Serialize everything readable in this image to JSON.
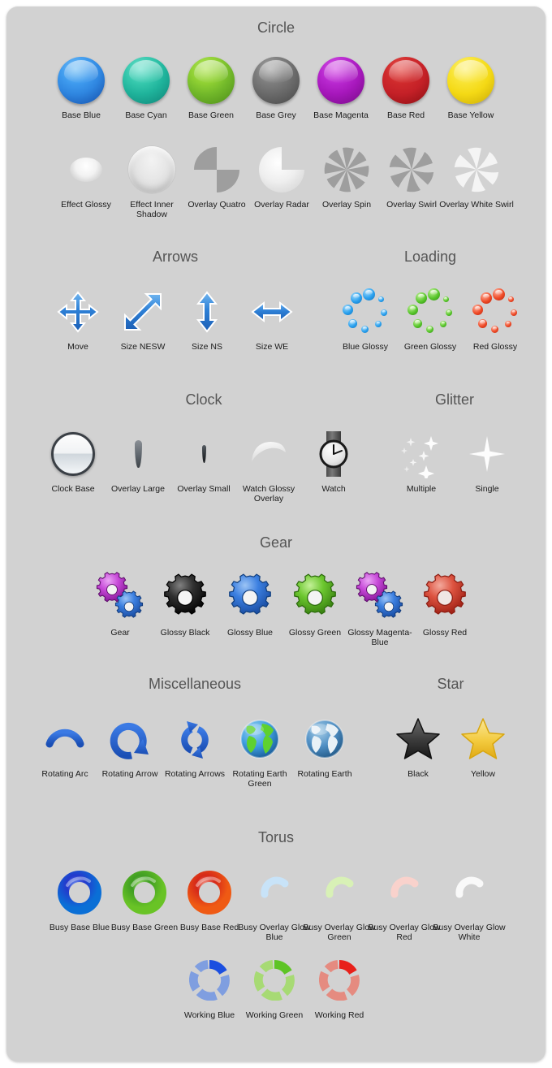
{
  "page": {
    "background": "#d2d2d2",
    "title_color": "#555555",
    "label_color": "#1b1b1b"
  },
  "sections": [
    {
      "id": "circle",
      "title": "Circle",
      "items": [
        {
          "label": "Base Blue",
          "icon": "circle-base-blue",
          "color": "#2f86e0"
        },
        {
          "label": "Base Cyan",
          "icon": "circle-base-cyan",
          "color": "#1fb39b"
        },
        {
          "label": "Base Green",
          "icon": "circle-base-green",
          "color": "#72b82a"
        },
        {
          "label": "Base Grey",
          "icon": "circle-base-grey",
          "color": "#6a6a6a"
        },
        {
          "label": "Base Magenta",
          "icon": "circle-base-magenta",
          "color": "#a617bb"
        },
        {
          "label": "Base Red",
          "icon": "circle-base-red",
          "color": "#c42027"
        },
        {
          "label": "Base Yellow",
          "icon": "circle-base-yellow",
          "color": "#f4d915"
        },
        {
          "label": "Effect Glossy",
          "icon": "circle-effect-glossy",
          "color": "#ffffff"
        },
        {
          "label": "Effect Inner Shadow",
          "icon": "circle-effect-inner-shadow",
          "color": "#e3e3e3"
        },
        {
          "label": "Overlay Quatro",
          "icon": "circle-overlay-quatro",
          "color": "#9e9e9e"
        },
        {
          "label": "Overlay Radar",
          "icon": "circle-overlay-radar",
          "color": "#f0f0f0"
        },
        {
          "label": "Overlay Spin",
          "icon": "circle-overlay-spin",
          "color": "#9e9e9e"
        },
        {
          "label": "Overlay Swirl",
          "icon": "circle-overlay-swirl",
          "color": "#9e9e9e"
        },
        {
          "label": "Overlay White Swirl",
          "icon": "circle-overlay-white-swirl",
          "color": "#f2f2f2"
        }
      ]
    },
    {
      "id": "arrows",
      "title": "Arrows",
      "items": [
        {
          "label": "Move",
          "icon": "arrow-move",
          "color": "#2a7fd4"
        },
        {
          "label": "Size NESW",
          "icon": "arrow-size-nesw",
          "color": "#2a7fd4"
        },
        {
          "label": "Size NS",
          "icon": "arrow-size-ns",
          "color": "#2a7fd4"
        },
        {
          "label": "Size WE",
          "icon": "arrow-size-we",
          "color": "#2a7fd4"
        }
      ]
    },
    {
      "id": "loading",
      "title": "Loading",
      "items": [
        {
          "label": "Blue Glossy",
          "icon": "loading-blue-glossy",
          "color": "#2196e8"
        },
        {
          "label": "Green Glossy",
          "icon": "loading-green-glossy",
          "color": "#4cb822"
        },
        {
          "label": "Red Glossy",
          "icon": "loading-red-glossy",
          "color": "#e8391a"
        }
      ]
    },
    {
      "id": "clock",
      "title": "Clock",
      "items": [
        {
          "label": "Clock Base",
          "icon": "clock-base",
          "color": "#3a3f45"
        },
        {
          "label": "Overlay Large",
          "icon": "clock-overlay-large",
          "color": "#5f666d"
        },
        {
          "label": "Overlay Small",
          "icon": "clock-overlay-small",
          "color": "#2b2f33"
        },
        {
          "label": "Watch Glossy Overlay",
          "icon": "clock-watch-glossy",
          "color": "#f0f0f0"
        },
        {
          "label": "Watch",
          "icon": "clock-watch",
          "color": "#1f1f1f"
        }
      ]
    },
    {
      "id": "glitter",
      "title": "Glitter",
      "items": [
        {
          "label": "Multiple",
          "icon": "glitter-multiple",
          "color": "#ffffff"
        },
        {
          "label": "Single",
          "icon": "glitter-single",
          "color": "#ffffff"
        }
      ]
    },
    {
      "id": "gear",
      "title": "Gear",
      "items": [
        {
          "label": "Gear",
          "icon": "gear-magenta-blue-pair",
          "color": "#c23fd4"
        },
        {
          "label": "Glossy Black",
          "icon": "gear-glossy-black",
          "color": "#2a2a2a"
        },
        {
          "label": "Glossy Blue",
          "icon": "gear-glossy-blue",
          "color": "#2f6fd8"
        },
        {
          "label": "Glossy Green",
          "icon": "gear-glossy-green",
          "color": "#5fc128"
        },
        {
          "label": "Glossy Magenta-Blue",
          "icon": "gear-glossy-magenta-blue",
          "color": "#c23fd4"
        },
        {
          "label": "Glossy Red",
          "icon": "gear-glossy-red",
          "color": "#d9422e"
        }
      ]
    },
    {
      "id": "miscellaneous",
      "title": "Miscellaneous",
      "items": [
        {
          "label": "Rotating Arc",
          "icon": "misc-rotating-arc",
          "color": "#2a6fd8"
        },
        {
          "label": "Rotating Arrow",
          "icon": "misc-rotating-arrow",
          "color": "#2a6fd8"
        },
        {
          "label": "Rotating Arrows",
          "icon": "misc-rotating-arrows",
          "color": "#2a6fd8"
        },
        {
          "label": "Rotating Earth Green",
          "icon": "misc-rotating-earth-green",
          "color": "#55c32c"
        },
        {
          "label": "Rotating Earth",
          "icon": "misc-rotating-earth",
          "color": "#4f8fc4"
        }
      ]
    },
    {
      "id": "star",
      "title": "Star",
      "items": [
        {
          "label": "Black",
          "icon": "star-black",
          "color": "#3b3b3b"
        },
        {
          "label": "Yellow",
          "icon": "star-yellow",
          "color": "#f4cc35"
        }
      ]
    },
    {
      "id": "torus",
      "title": "Torus",
      "items": [
        {
          "label": "Busy Base Blue",
          "icon": "torus-busy-base-blue",
          "color": "#1a3fd0"
        },
        {
          "label": "Busy Base Green",
          "icon": "torus-busy-base-green",
          "color": "#3d9f22"
        },
        {
          "label": "Busy Base Red",
          "icon": "torus-busy-base-red",
          "color": "#d9261a"
        },
        {
          "label": "Busy Overlay Glow Blue",
          "icon": "torus-busy-overlay-glow-blue",
          "color": "#bddff7"
        },
        {
          "label": "Busy Overlay Glow Green",
          "icon": "torus-busy-overlay-glow-green",
          "color": "#d3f0b0"
        },
        {
          "label": "Busy Overlay Glow Red",
          "icon": "torus-busy-overlay-glow-red",
          "color": "#fbcfc8"
        },
        {
          "label": "Busy Overlay Glow White",
          "icon": "torus-busy-overlay-glow-white",
          "color": "#f5f5f5"
        },
        {
          "label": "Working Blue",
          "icon": "torus-working-blue",
          "color": "#6f90d8"
        },
        {
          "label": "Working Green",
          "icon": "torus-working-green",
          "color": "#9ed36a"
        },
        {
          "label": "Working Red",
          "icon": "torus-working-red",
          "color": "#e07c72"
        }
      ]
    }
  ]
}
